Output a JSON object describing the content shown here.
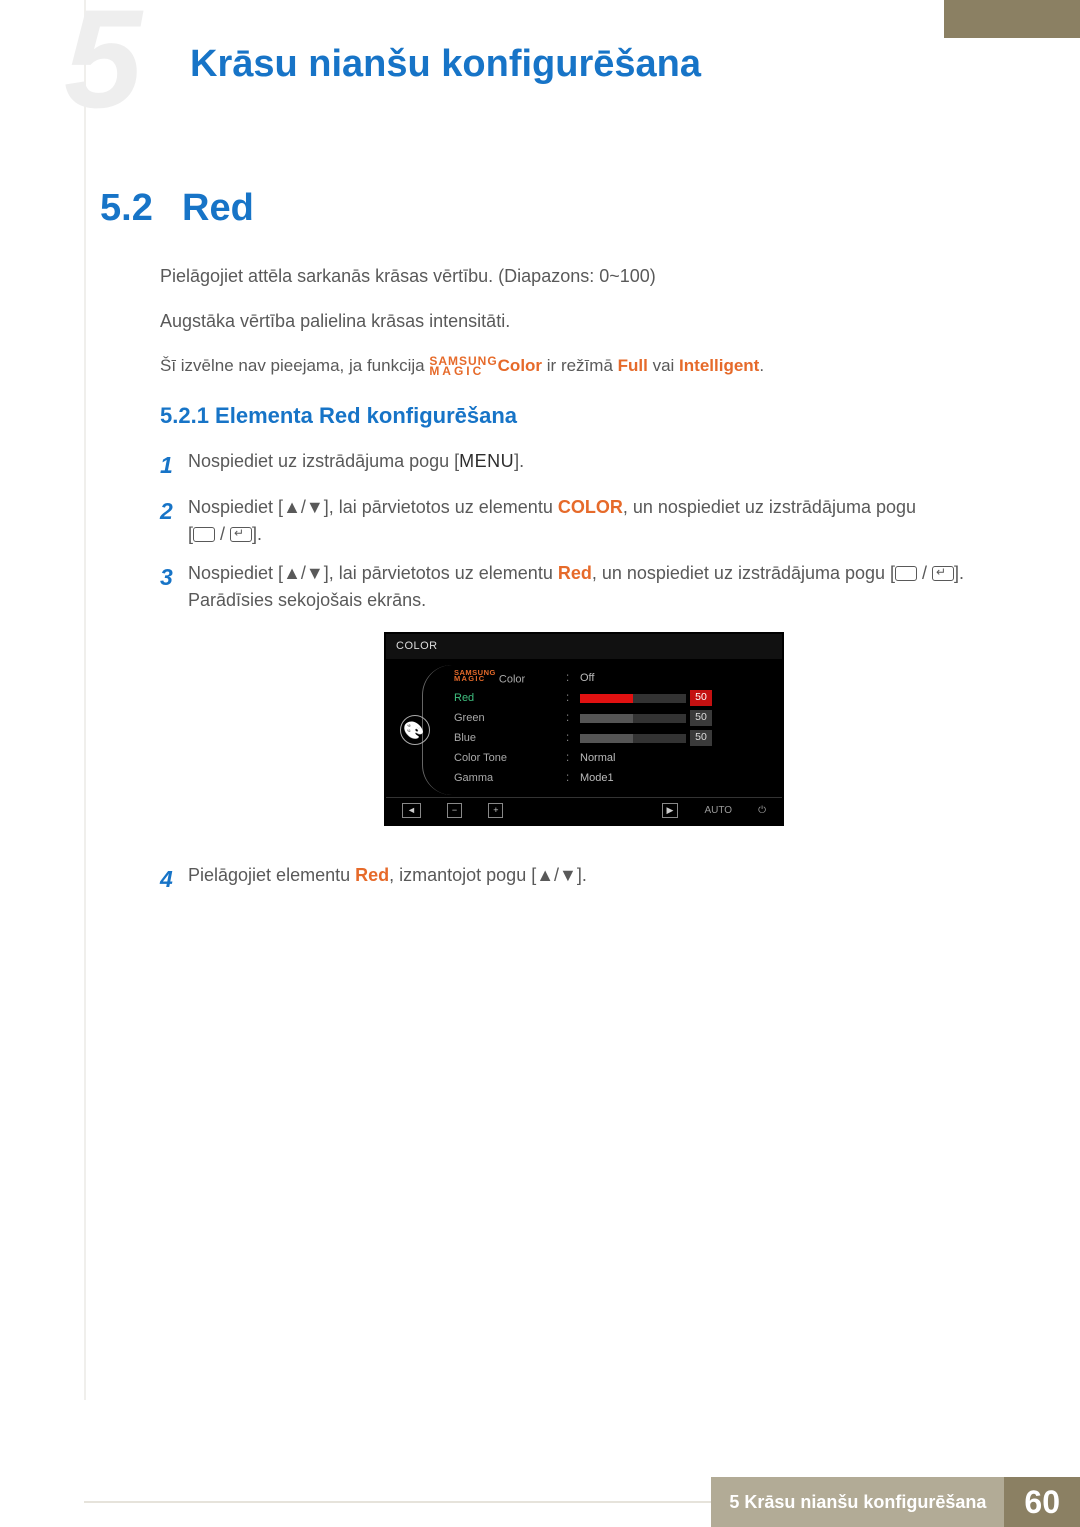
{
  "header": {
    "chapter_title": "Krāsu nianšu konfigurēšana",
    "bg_number": "5"
  },
  "section": {
    "number": "5.2",
    "title": "Red"
  },
  "paragraphs": {
    "p1": "Pielāgojiet attēla sarkanās krāsas vērtību. (Diapazons: 0~100)",
    "p2": "Augstāka vērtība palielina krāsas intensitāti."
  },
  "note": {
    "pre": "Šī izvēlne nav pieejama, ja funkcija ",
    "brand_l1": "SAMSUNG",
    "brand_l2": "MAGIC",
    "brand_after": "Color",
    "mid": " ir režīmā ",
    "full": "Full",
    "or": " vai ",
    "intelligent": "Intelligent",
    "end": "."
  },
  "subsection": {
    "number_title": "5.2.1   Elementa Red konfigurēšana"
  },
  "steps": {
    "s1": {
      "num": "1",
      "a": "Nospiediet uz izstrādājuma pogu [",
      "menu": "MENU",
      "b": "]."
    },
    "s2": {
      "num": "2",
      "a": "Nospiediet [",
      "arrows": "▲/▼",
      "b": "], lai pārvietotos uz elementu ",
      "color": "COLOR",
      "c": ", un nospiediet uz izstrādājuma pogu",
      "d": "[",
      "e": "]."
    },
    "s3": {
      "num": "3",
      "a": "Nospiediet [",
      "arrows": "▲/▼",
      "b": "], lai pārvietotos uz elementu ",
      "red": "Red",
      "c": ", un nospiediet uz izstrādājuma pogu [",
      "d": "].",
      "tail": "Parādīsies sekojošais ekrāns."
    },
    "s4": {
      "num": "4",
      "a": "Pielāgojiet elementu ",
      "red": "Red",
      "b": ", izmantojot pogu [",
      "arrows": "▲/▼",
      "c": "]."
    }
  },
  "osd": {
    "title": "COLOR",
    "magic_l1": "SAMSUNG",
    "magic_l2": "MAGIC",
    "rows": {
      "magic_color": {
        "label": " Color",
        "value": "Off"
      },
      "red": {
        "label": "Red",
        "value": "50"
      },
      "green": {
        "label": "Green",
        "value": "50"
      },
      "blue": {
        "label": "Blue",
        "value": "50"
      },
      "tone": {
        "label": "Color Tone",
        "value": "Normal"
      },
      "gamma": {
        "label": "Gamma",
        "value": "Mode1"
      }
    },
    "footer": {
      "back": "◄",
      "minus": "−",
      "plus": "+",
      "play": "▶",
      "auto": "AUTO",
      "power": "⏻"
    }
  },
  "footer": {
    "caption": "5 Krāsu nianšu konfigurēšana",
    "page": "60"
  }
}
